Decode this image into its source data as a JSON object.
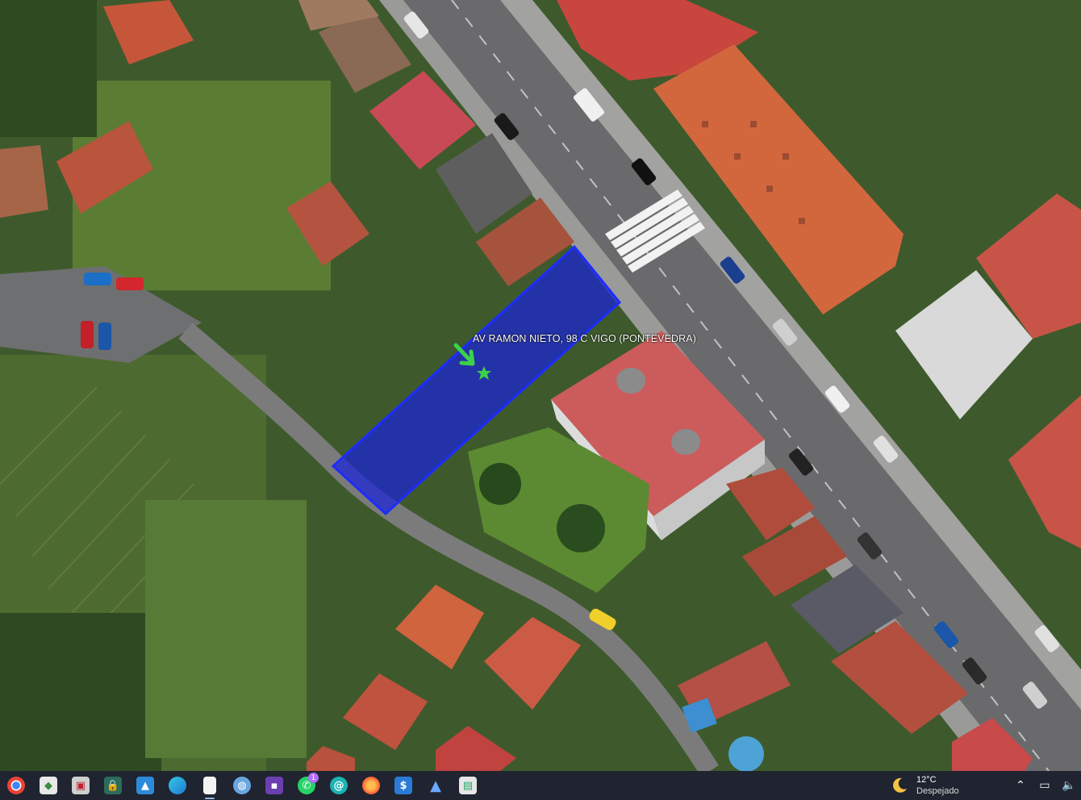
{
  "map": {
    "type": "satellite",
    "parcel_label": "AV RAMON NIETO, 98 C VIGO (PONTEVEDRA)",
    "parcel_color": "#1a23d8",
    "marker": "green-arrow-icon",
    "star": "green-star-icon"
  },
  "taskbar": {
    "apps": [
      {
        "name": "chrome-icon"
      },
      {
        "name": "maps-app-icon"
      },
      {
        "name": "file-explorer-icon"
      },
      {
        "name": "store-lock-icon"
      },
      {
        "name": "photos-icon"
      },
      {
        "name": "edge-icon"
      },
      {
        "name": "document-icon"
      },
      {
        "name": "globe-icon"
      },
      {
        "name": "save-floppy-icon"
      },
      {
        "name": "whatsapp-icon",
        "badge": "1"
      },
      {
        "name": "spiral-app-icon"
      },
      {
        "name": "firefox-icon"
      },
      {
        "name": "dollar-app-icon"
      },
      {
        "name": "triangle-app-icon"
      },
      {
        "name": "presentation-icon"
      }
    ],
    "weather": {
      "temp": "12°C",
      "desc": "Despejado"
    }
  }
}
